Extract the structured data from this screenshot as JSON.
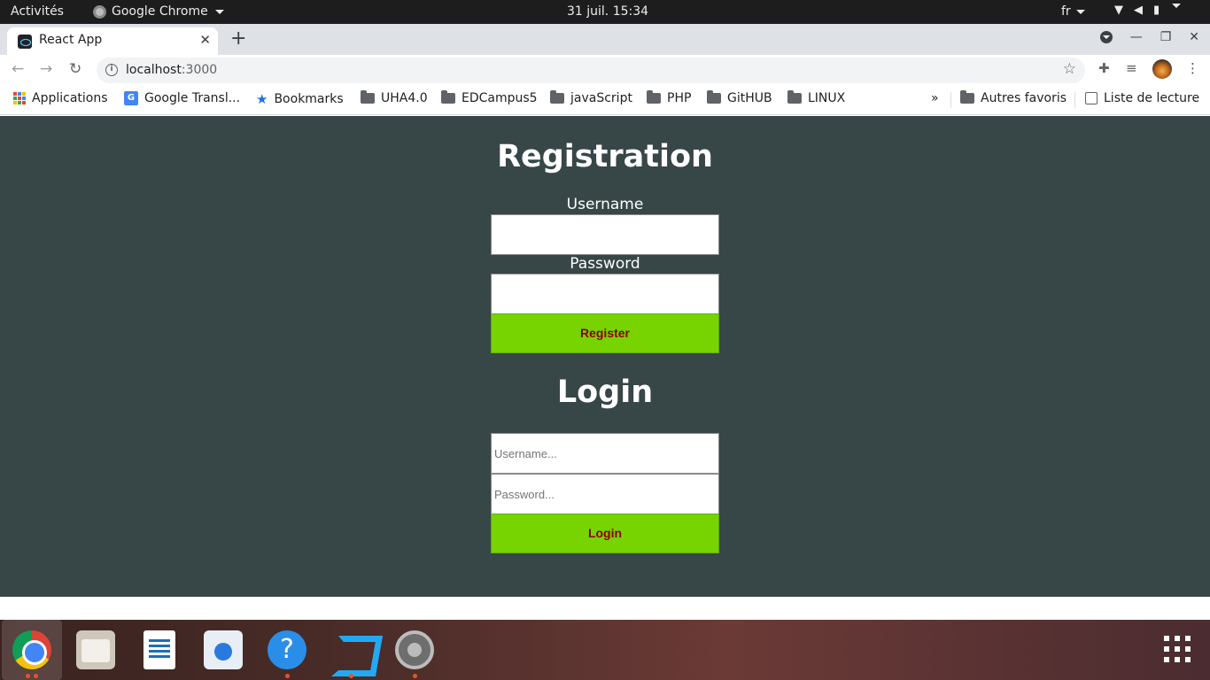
{
  "topbar": {
    "activities": "Activités",
    "app_name": "Google Chrome",
    "clock": "31 juil.  15:34",
    "language": "fr"
  },
  "browser": {
    "tab_title": "React App",
    "url_host": "localhost",
    "url_port": ":3000"
  },
  "bookmarks": {
    "items": [
      {
        "label": "Applications",
        "icon": "apps-grid-icon"
      },
      {
        "label": "Google Transl...",
        "icon": "google-translate-icon"
      },
      {
        "label": "Bookmarks",
        "icon": "star-icon"
      },
      {
        "label": "UHA4.0",
        "icon": "folder-icon"
      },
      {
        "label": "EDCampus5",
        "icon": "folder-icon"
      },
      {
        "label": "javaScript",
        "icon": "folder-icon"
      },
      {
        "label": "PHP",
        "icon": "folder-icon"
      },
      {
        "label": "GitHUB",
        "icon": "folder-icon"
      },
      {
        "label": "LINUX",
        "icon": "folder-icon"
      }
    ],
    "overflow": "»",
    "other": "Autres favoris",
    "reading_list": "Liste de lecture"
  },
  "registration": {
    "title": "Registration",
    "username_label": "Username",
    "username_value": "",
    "password_label": "Password",
    "password_value": "",
    "submit_label": "Register"
  },
  "login": {
    "title": "Login",
    "username_placeholder": "Username...",
    "password_placeholder": "Password...",
    "submit_label": "Login"
  },
  "colors": {
    "page_background": "#374646",
    "button_background": "#77d400",
    "button_text": "#8b0000"
  },
  "dock": {
    "items": [
      {
        "icon": "chrome-icon",
        "running": true,
        "active": true
      },
      {
        "icon": "files-icon",
        "running": false
      },
      {
        "icon": "libreoffice-writer-icon",
        "running": false
      },
      {
        "icon": "software-store-icon",
        "running": false
      },
      {
        "icon": "help-icon",
        "running": true
      },
      {
        "icon": "vscode-icon",
        "running": true
      },
      {
        "icon": "settings-icon",
        "running": true
      }
    ],
    "show_apps_icon": "apps-grid-icon"
  }
}
